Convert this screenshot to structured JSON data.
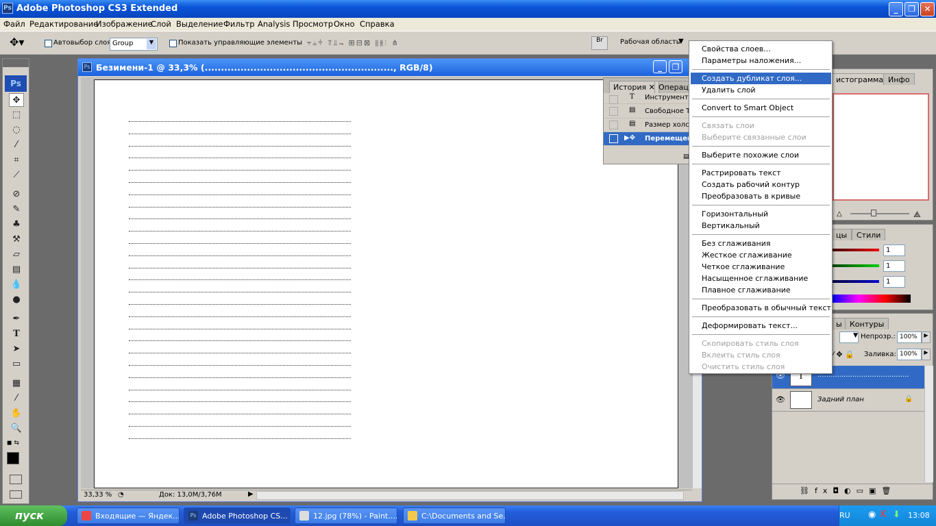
{
  "app": {
    "title": "Adobe Photoshop CS3 Extended"
  },
  "menubar": [
    "Файл",
    "Редактирование",
    "Изображение",
    "Слой",
    "Выделение",
    "Фильтр",
    "Analysis",
    "Просмотр",
    "Окно",
    "Справка"
  ],
  "options": {
    "autoselect_label": "Автовыбор слоя",
    "autoselect_value": "Group",
    "show_controls_label": "Показать управляющие элементы",
    "workspace_label": "Рабочая область"
  },
  "document": {
    "title": "Безимени-1 @ 33,3% (.........................................................., RGB/8)",
    "zoom": "33,33 %",
    "doc_info": "Док: 13,0М/3,76М",
    "dotted_line_count": 27
  },
  "history_panel": {
    "tabs": [
      "История",
      "Операци"
    ],
    "rows": [
      "Инструмент \"",
      "Свободное Тр",
      "Размер холст",
      "Перемещени"
    ]
  },
  "context_menu": {
    "items": [
      {
        "label": "Свойства слоев...",
        "state": "normal"
      },
      {
        "label": "Параметры наложения...",
        "state": "normal"
      },
      {
        "sep": true
      },
      {
        "label": "Создать дубликат слоя...",
        "state": "highlighted"
      },
      {
        "label": "Удалить слой",
        "state": "normal"
      },
      {
        "sep": true
      },
      {
        "label": "Convert to Smart Object",
        "state": "normal"
      },
      {
        "sep": true
      },
      {
        "label": "Связать слои",
        "state": "disabled"
      },
      {
        "label": "Выберите связанные слои",
        "state": "disabled"
      },
      {
        "sep": true
      },
      {
        "label": "Выберите похожие слои",
        "state": "normal"
      },
      {
        "sep": true
      },
      {
        "label": "Растрировать текст",
        "state": "normal"
      },
      {
        "label": "Создать рабочий контур",
        "state": "normal"
      },
      {
        "label": "Преобразовать в кривые",
        "state": "normal"
      },
      {
        "sep": true
      },
      {
        "label": "Горизонтальный",
        "state": "normal"
      },
      {
        "label": "Вертикальный",
        "state": "normal"
      },
      {
        "sep": true
      },
      {
        "label": "Без сглаживания",
        "state": "normal"
      },
      {
        "label": "Жесткое сглаживание",
        "state": "normal"
      },
      {
        "label": "Четкое сглаживание",
        "state": "normal"
      },
      {
        "label": "Насыщенное сглаживание",
        "state": "normal"
      },
      {
        "label": "Плавное сглаживание",
        "state": "normal"
      },
      {
        "sep": true
      },
      {
        "label": "Преобразовать в обычный текст",
        "state": "normal"
      },
      {
        "sep": true
      },
      {
        "label": "Деформировать текст...",
        "state": "normal"
      },
      {
        "sep": true
      },
      {
        "label": "Скопировать стиль слоя",
        "state": "disabled"
      },
      {
        "label": "Вклеить стиль слоя",
        "state": "disabled"
      },
      {
        "label": "Очистить стиль слоя",
        "state": "disabled"
      }
    ]
  },
  "navigator_panel": {
    "tabs": [
      "истограмма",
      "Инфо"
    ]
  },
  "color_panel": {
    "tabs": [
      "цы",
      "Стили"
    ],
    "values": [
      "1",
      "1",
      "1"
    ]
  },
  "layers_panel": {
    "tabs": [
      "ы",
      "Контуры"
    ],
    "opacity_label": "Непрозр.:",
    "opacity_value": "100%",
    "fill_label": "Заливка:",
    "fill_value": "100%",
    "layers": [
      {
        "name": "..........................................",
        "thumb": "T",
        "selected": true
      },
      {
        "name": "Задний план",
        "thumb": "",
        "selected": false
      }
    ]
  },
  "taskbar": {
    "start": "пуск",
    "tasks": [
      "Входящие — Яндек...",
      "Adobe Photoshop CS...",
      "12.jpg (78%) - Paint....",
      "C:\\Documents and Se..."
    ],
    "lang": "RU",
    "time": "13:08"
  }
}
